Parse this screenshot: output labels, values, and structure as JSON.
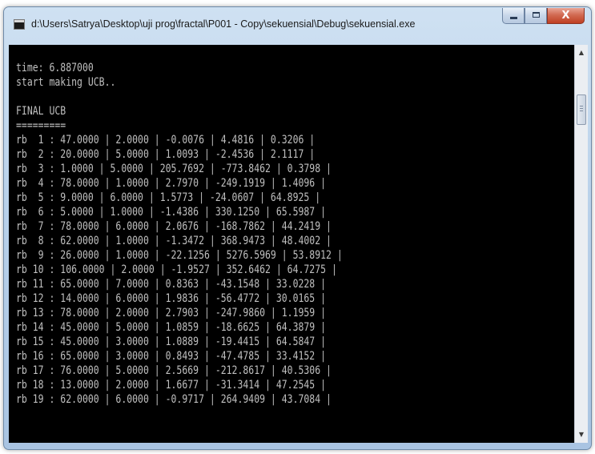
{
  "window": {
    "title": "d:\\Users\\Satrya\\Desktop\\uji prog\\fractal\\P001 - Copy\\sekuensial\\Debug\\sekuensial.exe",
    "controls": {
      "minimize": "",
      "maximize": "",
      "close": "X"
    }
  },
  "console": {
    "lines": [
      "time: 6.887000",
      "start making UCB..",
      "",
      "FINAL UCB",
      "=========",
      "rb  1 : 47.0000 | 2.0000 | -0.0076 | 4.4816 | 0.3206 |",
      "rb  2 : 20.0000 | 5.0000 | 1.0093 | -2.4536 | 2.1117 |",
      "rb  3 : 1.0000 | 5.0000 | 205.7692 | -773.8462 | 0.3798 |",
      "rb  4 : 78.0000 | 1.0000 | 2.7970 | -249.1919 | 1.4096 |",
      "rb  5 : 9.0000 | 6.0000 | 1.5773 | -24.0607 | 64.8925 |",
      "rb  6 : 5.0000 | 1.0000 | -1.4386 | 330.1250 | 65.5987 |",
      "rb  7 : 78.0000 | 6.0000 | 2.0676 | -168.7862 | 44.2419 |",
      "rb  8 : 62.0000 | 1.0000 | -1.3472 | 368.9473 | 48.4002 |",
      "rb  9 : 26.0000 | 1.0000 | -22.1256 | 5276.5969 | 53.8912 |",
      "rb 10 : 106.0000 | 2.0000 | -1.9527 | 352.6462 | 64.7275 |",
      "rb 11 : 65.0000 | 7.0000 | 0.8363 | -43.1548 | 33.0228 |",
      "rb 12 : 14.0000 | 6.0000 | 1.9836 | -56.4772 | 30.0165 |",
      "rb 13 : 78.0000 | 2.0000 | 2.7903 | -247.9860 | 1.1959 |",
      "rb 14 : 45.0000 | 5.0000 | 1.0859 | -18.6625 | 64.3879 |",
      "rb 15 : 45.0000 | 3.0000 | 1.0889 | -19.4415 | 64.5847 |",
      "rb 16 : 65.0000 | 3.0000 | 0.8493 | -47.4785 | 33.4152 |",
      "rb 17 : 76.0000 | 5.0000 | 2.5669 | -212.8617 | 40.5306 |",
      "rb 18 : 13.0000 | 2.0000 | 1.6677 | -31.3414 | 47.2545 |",
      "rb 19 : 62.0000 | 6.0000 | -0.9717 | 264.9409 | 43.7084 |"
    ]
  },
  "scrollbar": {
    "up_arrow": "▲",
    "down_arrow": "▼"
  }
}
